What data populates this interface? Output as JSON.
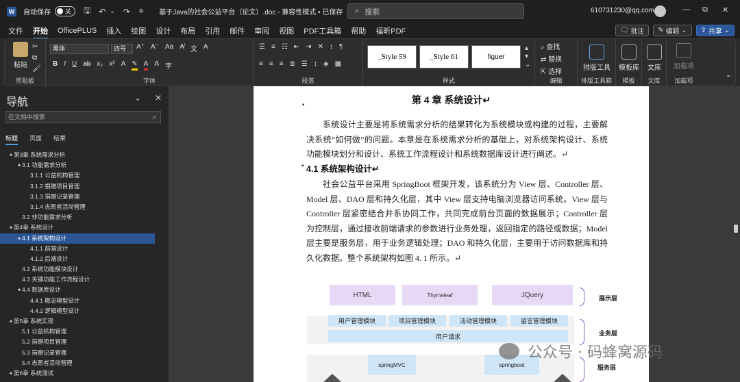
{
  "titlebar": {
    "autosave_label": "自动保存",
    "autosave_state": "关",
    "doc_title": "基于Java的社会公益平台（论文）.doc - 兼容性模式 • 已保存",
    "search_placeholder": "搜索",
    "account": "610731230@qq.com"
  },
  "menu": {
    "tabs": [
      "文件",
      "开始",
      "OfficePLUS",
      "插入",
      "绘图",
      "设计",
      "布局",
      "引用",
      "邮件",
      "审阅",
      "视图",
      "PDF工具箱",
      "帮助",
      "福昕PDF"
    ],
    "comment_btn": "批注",
    "edit_btn": "编辑",
    "share_btn": "共享"
  },
  "ribbon": {
    "paste_label": "粘贴",
    "clipboard_label": "剪贴板",
    "font_name": "黑体",
    "font_size": "四号",
    "font_label": "字体",
    "paragraph_label": "段落",
    "styles": [
      "_Style 59",
      "_Style 61",
      "figuer"
    ],
    "styles_label": "样式",
    "find_label": "查找",
    "replace_label": "替换",
    "select_label": "选择",
    "editing_label": "编辑",
    "layout_tool_label": "排版工具",
    "layout_tool_group": "排版工具箱",
    "template_label": "模板库",
    "template_group": "模板",
    "library_label": "文库",
    "library_group": "文库",
    "addin_label": "加载项",
    "addin_group": "加载项"
  },
  "nav": {
    "title": "导航",
    "search_placeholder": "在文档中搜索",
    "tabs": [
      "标题",
      "页面",
      "结果"
    ],
    "items": [
      {
        "level": 1,
        "text": "第3章 系统需求分析",
        "expand": "▲"
      },
      {
        "level": 2,
        "text": "3.1 功能需求分析",
        "expand": "▲"
      },
      {
        "level": 3,
        "text": "3.1.1 公益机构管理",
        "expand": ""
      },
      {
        "level": 3,
        "text": "3.1.2 捐赠项目管理",
        "expand": ""
      },
      {
        "level": 3,
        "text": "3.1.3 捐赠记录管理",
        "expand": ""
      },
      {
        "level": 3,
        "text": "3.1.4 志愿者活动管理",
        "expand": ""
      },
      {
        "level": 2,
        "text": "3.2 非功能需求分析",
        "expand": ""
      },
      {
        "level": 1,
        "text": "第4章 系统设计",
        "expand": "▲"
      },
      {
        "level": 2,
        "text": "4.1 系统架构设计",
        "expand": "▲",
        "selected": true
      },
      {
        "level": 3,
        "text": "4.1.1 前端设计",
        "expand": ""
      },
      {
        "level": 3,
        "text": "4.1.2 后端设计",
        "expand": ""
      },
      {
        "level": 2,
        "text": "4.2 系统功能模块设计",
        "expand": ""
      },
      {
        "level": 2,
        "text": "4.3 关键功能工作流程设计",
        "expand": ""
      },
      {
        "level": 2,
        "text": "4.4 数据库设计",
        "expand": "▲"
      },
      {
        "level": 3,
        "text": "4.4.1 概念模型设计",
        "expand": ""
      },
      {
        "level": 3,
        "text": "4.4.2 逻辑模型设计",
        "expand": ""
      },
      {
        "level": 1,
        "text": "第5章 系统实现",
        "expand": "▲"
      },
      {
        "level": 2,
        "text": "5.1 公益机构管理",
        "expand": ""
      },
      {
        "level": 2,
        "text": "5.2 捐赠项目管理",
        "expand": ""
      },
      {
        "level": 2,
        "text": "5.3 捐赠记录管理",
        "expand": ""
      },
      {
        "level": 2,
        "text": "5.4 志愿者活动管理",
        "expand": ""
      },
      {
        "level": 1,
        "text": "第6章 系统测试",
        "expand": "▲"
      }
    ]
  },
  "document": {
    "chapter_title": "第 4 章  系统设计↵",
    "intro": "系统设计主要是将系统需求分析的结果转化为系统模块或构建的过程，主要解决系统“如何做”的问题。本章是在系统需求分析的基础上，对系统架构设计、系统功能模块划分和设计、系统工作流程设计和系统数据库设计进行阐述。↵",
    "section_title": "4.1   系统架构设计↵",
    "body": "社会公益平台采用 SpringBoot 框架开发，该系统分为 View 层、Controller 层、Model 层、DAO 层和持久化层，其中 View 层支持电脑浏览器访问系统。View 层与 Controller 层紧密结合并系协同工作，共同完成前台页面的数据展示；Controller 层为控制层，通过接收前端请求的参数进行业务处理，返回指定的路径或数据；Model 层主要是服务层，用于业务逻辑处理；DAO 和持久化层，主要用于访问数据库和持久化数据。整个系统架构如图 4. 1 所示。↵",
    "diagram": {
      "presentation": [
        "HTML",
        "Thymeleaf",
        "JQuery"
      ],
      "presentation_label": "展示层",
      "business_modules": [
        "用户管理模块",
        "项目管理模块",
        "活动管理模块",
        "留言管理模块"
      ],
      "user_request": "用户请求",
      "business_label": "业务层",
      "service": [
        "springMVC",
        "springboot"
      ],
      "service_label": "服务层"
    }
  },
  "watermark": "公众号 · 码蜂窝源码"
}
